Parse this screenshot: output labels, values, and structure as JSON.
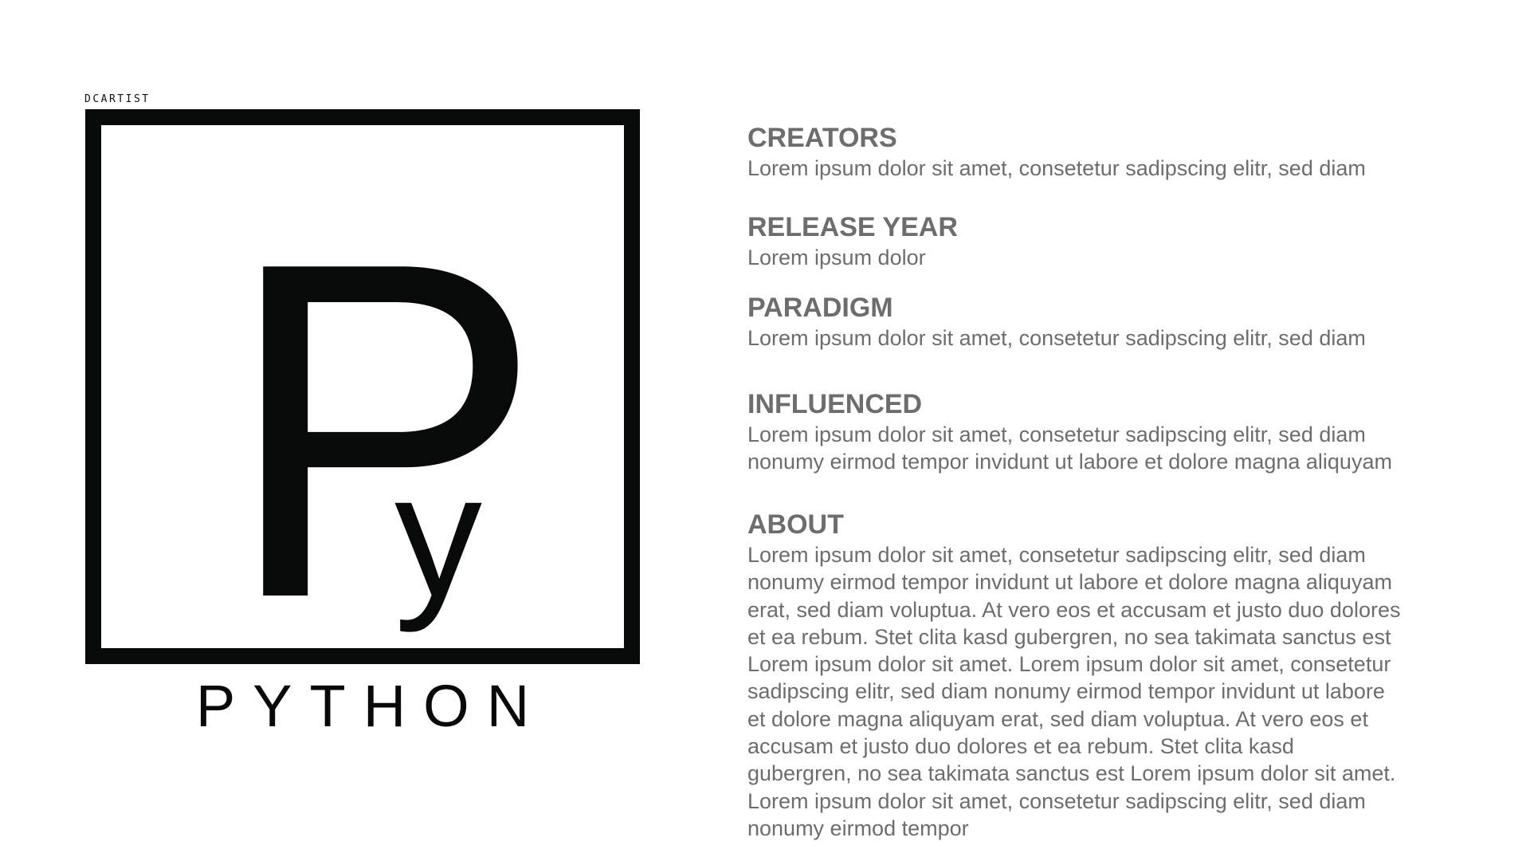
{
  "brand": {
    "label": "DCARTIST"
  },
  "logo": {
    "big_letter": "P",
    "small_letter": "y",
    "name": "PYTHON",
    "stroke_color": "#080a0a"
  },
  "sections": [
    {
      "heading": "CREATORS",
      "lines": [
        "Lorem ipsum dolor sit amet, consetetur sadipscing elitr, sed diam"
      ]
    },
    {
      "heading": "RELEASE YEAR",
      "lines": [
        "Lorem ipsum dolor"
      ]
    },
    {
      "heading": "PARADIGM",
      "lines": [
        "Lorem ipsum dolor sit amet, consetetur sadipscing elitr, sed diam"
      ]
    },
    {
      "heading": "INFLUENCED",
      "lines": [
        "Lorem ipsum dolor sit amet, consetetur sadipscing elitr, sed diam",
        "nonumy eirmod tempor invidunt ut labore et dolore magna aliquyam"
      ]
    },
    {
      "heading": "ABOUT",
      "lines": [
        "Lorem ipsum dolor sit amet, consetetur sadipscing elitr, sed diam",
        "nonumy eirmod tempor invidunt ut labore et dolore magna aliquyam",
        "erat, sed diam voluptua. At vero eos et accusam et justo duo dolores",
        "et ea rebum. Stet clita kasd gubergren, no sea takimata sanctus est",
        "Lorem ipsum dolor sit amet. Lorem ipsum dolor sit amet, consetetur",
        "sadipscing elitr, sed diam nonumy eirmod tempor invidunt ut labore",
        "et dolore magna aliquyam erat, sed diam voluptua. At vero eos et",
        "accusam et justo duo dolores et ea rebum. Stet clita kasd",
        "gubergren, no sea takimata sanctus est Lorem ipsum dolor sit amet.",
        "Lorem ipsum dolor sit amet, consetetur sadipscing elitr, sed diam",
        "nonumy eirmod tempor"
      ]
    }
  ],
  "colors": {
    "heading": "#6d6d6d",
    "body": "#6d6d6d",
    "logo": "#080a0a"
  }
}
